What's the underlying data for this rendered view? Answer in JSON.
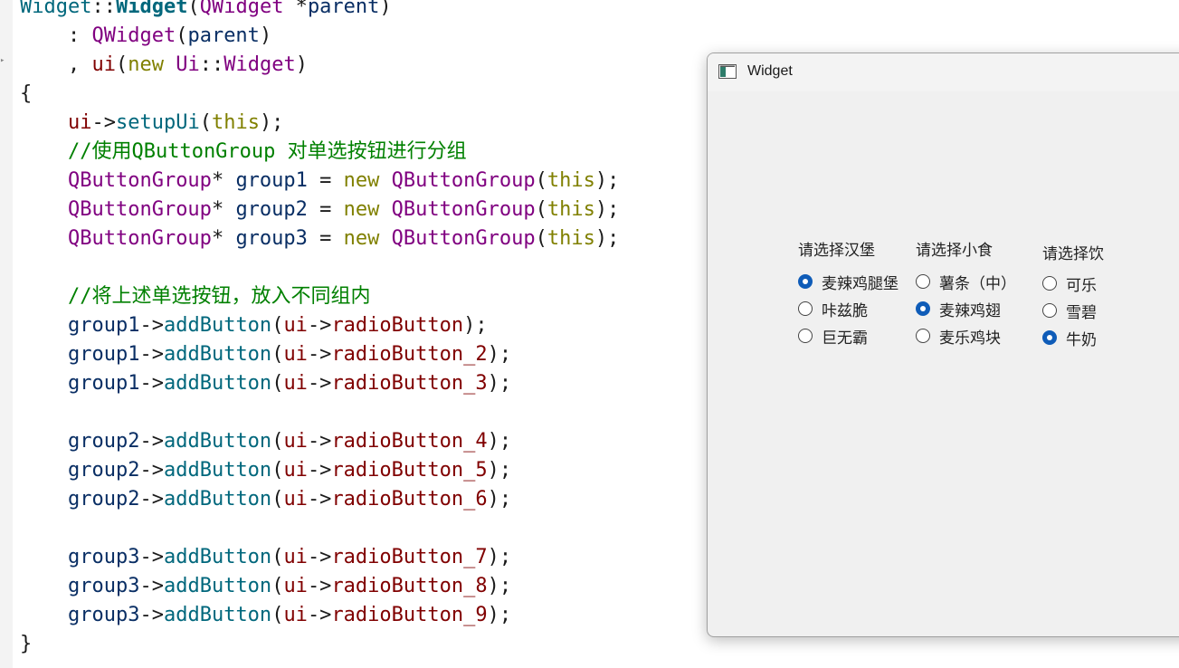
{
  "code_lines": [
    [
      {
        "t": "Widget",
        "c": "t-func"
      },
      {
        "t": "::",
        "c": "t-default"
      },
      {
        "t": "Widget",
        "c": "t-bold"
      },
      {
        "t": "(",
        "c": "t-default"
      },
      {
        "t": "QWidget",
        "c": "t-type"
      },
      {
        "t": " *",
        "c": "t-default"
      },
      {
        "t": "parent",
        "c": "t-param"
      },
      {
        "t": ")",
        "c": "t-default"
      }
    ],
    [
      {
        "t": "    : ",
        "c": "t-default"
      },
      {
        "t": "QWidget",
        "c": "t-type"
      },
      {
        "t": "(",
        "c": "t-default"
      },
      {
        "t": "parent",
        "c": "t-param"
      },
      {
        "t": ")",
        "c": "t-default"
      }
    ],
    [
      {
        "t": "    , ",
        "c": "t-default"
      },
      {
        "t": "ui",
        "c": "t-member"
      },
      {
        "t": "(",
        "c": "t-default"
      },
      {
        "t": "new",
        "c": "t-keyword"
      },
      {
        "t": " ",
        "c": "t-default"
      },
      {
        "t": "Ui",
        "c": "t-type"
      },
      {
        "t": "::",
        "c": "t-default"
      },
      {
        "t": "Widget",
        "c": "t-type"
      },
      {
        "t": ")",
        "c": "t-default"
      }
    ],
    [
      {
        "t": "{",
        "c": "t-default"
      }
    ],
    [
      {
        "t": "    ",
        "c": "t-default"
      },
      {
        "t": "ui",
        "c": "t-member"
      },
      {
        "t": "->",
        "c": "t-default"
      },
      {
        "t": "setupUi",
        "c": "t-func"
      },
      {
        "t": "(",
        "c": "t-default"
      },
      {
        "t": "this",
        "c": "t-this"
      },
      {
        "t": ");",
        "c": "t-default"
      }
    ],
    [
      {
        "t": "    //使用QButtonGroup 对单选按钮进行分组",
        "c": "t-comment"
      }
    ],
    [
      {
        "t": "    ",
        "c": "t-default"
      },
      {
        "t": "QButtonGroup",
        "c": "t-type"
      },
      {
        "t": "* ",
        "c": "t-default"
      },
      {
        "t": "group1",
        "c": "t-local"
      },
      {
        "t": " = ",
        "c": "t-default"
      },
      {
        "t": "new",
        "c": "t-keyword"
      },
      {
        "t": " ",
        "c": "t-default"
      },
      {
        "t": "QButtonGroup",
        "c": "t-type"
      },
      {
        "t": "(",
        "c": "t-default"
      },
      {
        "t": "this",
        "c": "t-this"
      },
      {
        "t": ");",
        "c": "t-default"
      }
    ],
    [
      {
        "t": "    ",
        "c": "t-default"
      },
      {
        "t": "QButtonGroup",
        "c": "t-type"
      },
      {
        "t": "* ",
        "c": "t-default"
      },
      {
        "t": "group2",
        "c": "t-local"
      },
      {
        "t": " = ",
        "c": "t-default"
      },
      {
        "t": "new",
        "c": "t-keyword"
      },
      {
        "t": " ",
        "c": "t-default"
      },
      {
        "t": "QButtonGroup",
        "c": "t-type"
      },
      {
        "t": "(",
        "c": "t-default"
      },
      {
        "t": "this",
        "c": "t-this"
      },
      {
        "t": ");",
        "c": "t-default"
      }
    ],
    [
      {
        "t": "    ",
        "c": "t-default"
      },
      {
        "t": "QButtonGroup",
        "c": "t-type"
      },
      {
        "t": "* ",
        "c": "t-default"
      },
      {
        "t": "group3",
        "c": "t-local"
      },
      {
        "t": " = ",
        "c": "t-default"
      },
      {
        "t": "new",
        "c": "t-keyword"
      },
      {
        "t": " ",
        "c": "t-default"
      },
      {
        "t": "QButtonGroup",
        "c": "t-type"
      },
      {
        "t": "(",
        "c": "t-default"
      },
      {
        "t": "this",
        "c": "t-this"
      },
      {
        "t": ");",
        "c": "t-default"
      }
    ],
    [
      {
        "t": "",
        "c": "t-default"
      }
    ],
    [
      {
        "t": "    //将上述单选按钮，放入不同组内",
        "c": "t-comment"
      }
    ],
    [
      {
        "t": "    ",
        "c": "t-default"
      },
      {
        "t": "group1",
        "c": "t-local"
      },
      {
        "t": "->",
        "c": "t-default"
      },
      {
        "t": "addButton",
        "c": "t-func"
      },
      {
        "t": "(",
        "c": "t-default"
      },
      {
        "t": "ui",
        "c": "t-member"
      },
      {
        "t": "->",
        "c": "t-default"
      },
      {
        "t": "radioButton",
        "c": "t-member"
      },
      {
        "t": ");",
        "c": "t-default"
      }
    ],
    [
      {
        "t": "    ",
        "c": "t-default"
      },
      {
        "t": "group1",
        "c": "t-local"
      },
      {
        "t": "->",
        "c": "t-default"
      },
      {
        "t": "addButton",
        "c": "t-func"
      },
      {
        "t": "(",
        "c": "t-default"
      },
      {
        "t": "ui",
        "c": "t-member"
      },
      {
        "t": "->",
        "c": "t-default"
      },
      {
        "t": "radioButton_2",
        "c": "t-member"
      },
      {
        "t": ");",
        "c": "t-default"
      }
    ],
    [
      {
        "t": "    ",
        "c": "t-default"
      },
      {
        "t": "group1",
        "c": "t-local"
      },
      {
        "t": "->",
        "c": "t-default"
      },
      {
        "t": "addButton",
        "c": "t-func"
      },
      {
        "t": "(",
        "c": "t-default"
      },
      {
        "t": "ui",
        "c": "t-member"
      },
      {
        "t": "->",
        "c": "t-default"
      },
      {
        "t": "radioButton_3",
        "c": "t-member"
      },
      {
        "t": ");",
        "c": "t-default"
      }
    ],
    [
      {
        "t": "",
        "c": "t-default"
      }
    ],
    [
      {
        "t": "    ",
        "c": "t-default"
      },
      {
        "t": "group2",
        "c": "t-local"
      },
      {
        "t": "->",
        "c": "t-default"
      },
      {
        "t": "addButton",
        "c": "t-func"
      },
      {
        "t": "(",
        "c": "t-default"
      },
      {
        "t": "ui",
        "c": "t-member"
      },
      {
        "t": "->",
        "c": "t-default"
      },
      {
        "t": "radioButton_4",
        "c": "t-member"
      },
      {
        "t": ");",
        "c": "t-default"
      }
    ],
    [
      {
        "t": "    ",
        "c": "t-default"
      },
      {
        "t": "group2",
        "c": "t-local"
      },
      {
        "t": "->",
        "c": "t-default"
      },
      {
        "t": "addButton",
        "c": "t-func"
      },
      {
        "t": "(",
        "c": "t-default"
      },
      {
        "t": "ui",
        "c": "t-member"
      },
      {
        "t": "->",
        "c": "t-default"
      },
      {
        "t": "radioButton_5",
        "c": "t-member"
      },
      {
        "t": ");",
        "c": "t-default"
      }
    ],
    [
      {
        "t": "    ",
        "c": "t-default"
      },
      {
        "t": "group2",
        "c": "t-local"
      },
      {
        "t": "->",
        "c": "t-default"
      },
      {
        "t": "addButton",
        "c": "t-func"
      },
      {
        "t": "(",
        "c": "t-default"
      },
      {
        "t": "ui",
        "c": "t-member"
      },
      {
        "t": "->",
        "c": "t-default"
      },
      {
        "t": "radioButton_6",
        "c": "t-member"
      },
      {
        "t": ");",
        "c": "t-default"
      }
    ],
    [
      {
        "t": "",
        "c": "t-default"
      }
    ],
    [
      {
        "t": "    ",
        "c": "t-default"
      },
      {
        "t": "group3",
        "c": "t-local"
      },
      {
        "t": "->",
        "c": "t-default"
      },
      {
        "t": "addButton",
        "c": "t-func"
      },
      {
        "t": "(",
        "c": "t-default"
      },
      {
        "t": "ui",
        "c": "t-member"
      },
      {
        "t": "->",
        "c": "t-default"
      },
      {
        "t": "radioButton_7",
        "c": "t-member"
      },
      {
        "t": ");",
        "c": "t-default"
      }
    ],
    [
      {
        "t": "    ",
        "c": "t-default"
      },
      {
        "t": "group3",
        "c": "t-local"
      },
      {
        "t": "->",
        "c": "t-default"
      },
      {
        "t": "addButton",
        "c": "t-func"
      },
      {
        "t": "(",
        "c": "t-default"
      },
      {
        "t": "ui",
        "c": "t-member"
      },
      {
        "t": "->",
        "c": "t-default"
      },
      {
        "t": "radioButton_8",
        "c": "t-member"
      },
      {
        "t": ");",
        "c": "t-default"
      }
    ],
    [
      {
        "t": "    ",
        "c": "t-default"
      },
      {
        "t": "group3",
        "c": "t-local"
      },
      {
        "t": "->",
        "c": "t-default"
      },
      {
        "t": "addButton",
        "c": "t-func"
      },
      {
        "t": "(",
        "c": "t-default"
      },
      {
        "t": "ui",
        "c": "t-member"
      },
      {
        "t": "->",
        "c": "t-default"
      },
      {
        "t": "radioButton_9",
        "c": "t-member"
      },
      {
        "t": ");",
        "c": "t-default"
      }
    ],
    [
      {
        "t": "}",
        "c": "t-default"
      }
    ]
  ],
  "window": {
    "title": "Widget",
    "groups": [
      {
        "title": "请选择汉堡",
        "options": [
          {
            "label": "麦辣鸡腿堡",
            "checked": true
          },
          {
            "label": "咔兹脆",
            "checked": false
          },
          {
            "label": "巨无霸",
            "checked": false
          }
        ]
      },
      {
        "title": "请选择小食",
        "options": [
          {
            "label": "薯条（中）",
            "checked": false
          },
          {
            "label": "麦辣鸡翅",
            "checked": true
          },
          {
            "label": "麦乐鸡块",
            "checked": false
          }
        ]
      },
      {
        "title": "请选择饮",
        "options": [
          {
            "label": "可乐",
            "checked": false
          },
          {
            "label": "雪碧",
            "checked": false
          },
          {
            "label": "牛奶",
            "checked": true
          }
        ]
      }
    ]
  },
  "colors": {
    "accent": "#0f5cb8"
  }
}
